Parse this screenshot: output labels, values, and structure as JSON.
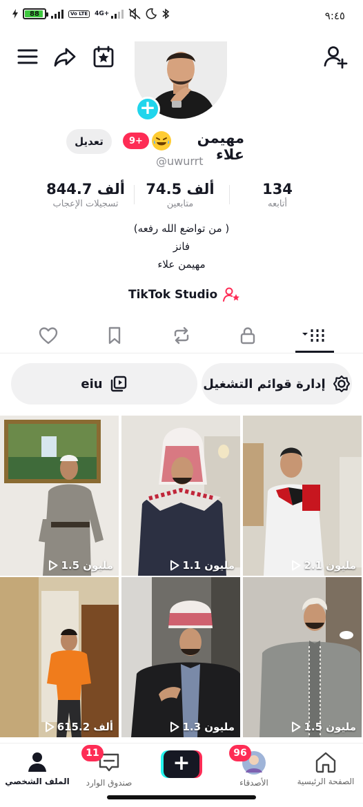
{
  "status_bar": {
    "battery": "88",
    "network": "4G+",
    "volte": "Vo LTE",
    "time": "٩:٤٥"
  },
  "profile": {
    "display_name": "مهيمن علاء",
    "username": "@uwurrt",
    "badge": "9+",
    "edit_label": "تعديل",
    "stats": [
      {
        "value": "134",
        "label": "أتابعه"
      },
      {
        "value": "74.5 ألف",
        "label": "متابعين"
      },
      {
        "value": "844.7 ألف",
        "label": "تسجيلات الإعجاب"
      }
    ],
    "bio_lines": [
      "(من تواضع الله رفعه )",
      "فانز",
      "مهيمن علاء"
    ],
    "studio_label": "TikTok Studio"
  },
  "action_pills": {
    "playlists_label": "إدارة قوائم التشغيل",
    "collection_label": "eiu"
  },
  "videos": [
    {
      "views": "2.1 مليون"
    },
    {
      "views": "1.1 مليون"
    },
    {
      "views": "1.5 مليون"
    },
    {
      "views": "1.5 مليون"
    },
    {
      "views": "1.3 مليون"
    },
    {
      "views": "615.2 ألف"
    }
  ],
  "bottom_nav": {
    "home": "الصفحة الرئيسية",
    "friends": "الأصدقاء",
    "friends_badge": "96",
    "inbox": "صندوق الوارد",
    "inbox_badge": "11",
    "profile": "الملف الشخصي"
  },
  "colors": {
    "accent": "#fe2c55",
    "cyan": "#20d5ec",
    "text": "#161823",
    "secondary": "#8a8b91"
  }
}
